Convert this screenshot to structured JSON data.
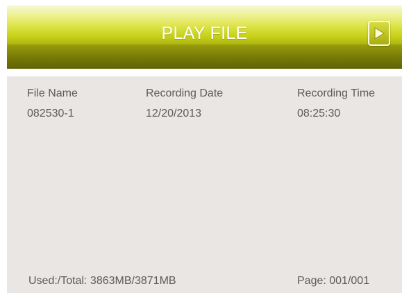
{
  "header": {
    "title": "PLAY FILE",
    "play_icon": "play-icon"
  },
  "table": {
    "columns": [
      "File Name",
      "Recording Date",
      "Recording Time"
    ],
    "rows": [
      {
        "file_name": "082530-1",
        "recording_date": "12/20/2013",
        "recording_time": "08:25:30"
      }
    ]
  },
  "footer": {
    "storage_label": "Used:/Total: 3863MB/3871MB",
    "page_label": "Page: 001/001"
  },
  "colors": {
    "header_accent": "#c8d21a",
    "content_bg": "#e9e6e3",
    "text": "#5b5b5b"
  }
}
